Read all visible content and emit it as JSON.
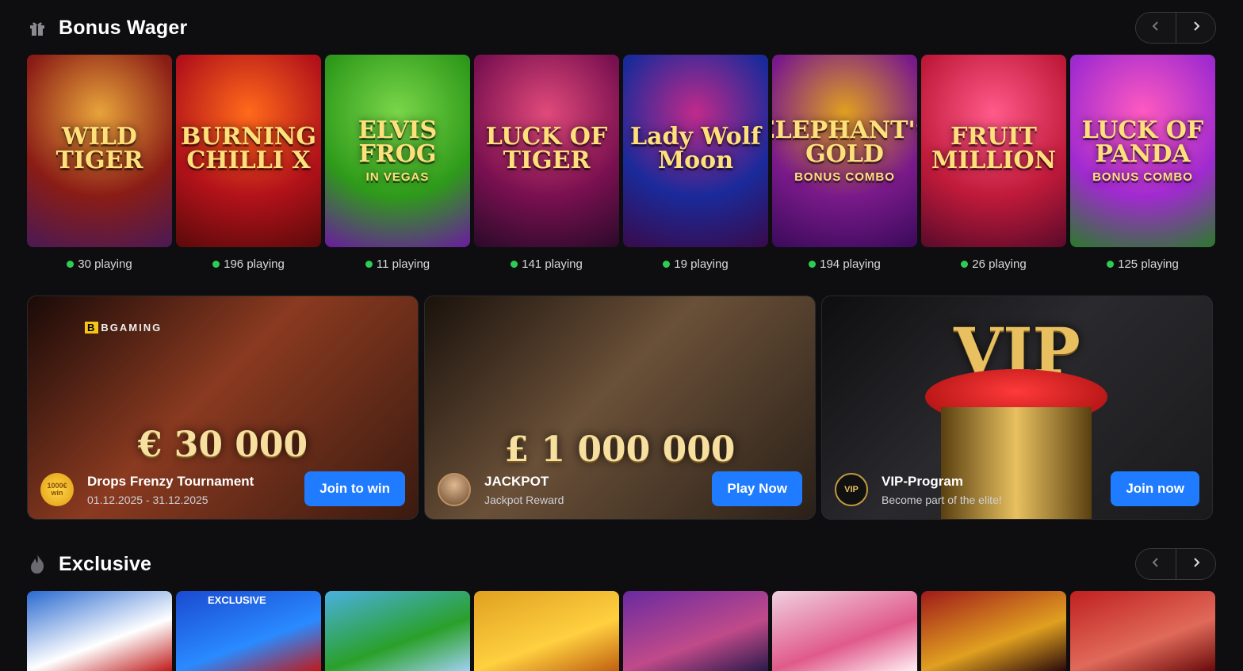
{
  "sections": {
    "bonus_wager": {
      "title": "Bonus Wager"
    },
    "exclusive": {
      "title": "Exclusive"
    }
  },
  "bonus_games": [
    {
      "name": "WILD TIGER",
      "sub": "",
      "playing": "30 playing",
      "colors": [
        "#8a1c16",
        "#e8a33a",
        "#4a1a55"
      ]
    },
    {
      "name": "BURNING CHILLI X",
      "sub": "",
      "playing": "196 playing",
      "colors": [
        "#b3121a",
        "#ff6a1a",
        "#5a0a0a"
      ]
    },
    {
      "name": "ELVIS FROG",
      "sub": "IN VEGAS",
      "playing": "11 playing",
      "colors": [
        "#2e9a1a",
        "#7ad64a",
        "#6a1aa0"
      ]
    },
    {
      "name": "LUCK OF TIGER",
      "sub": "",
      "playing": "141 playing",
      "colors": [
        "#7a1050",
        "#e04a7a",
        "#2a0a2a"
      ]
    },
    {
      "name": "Lady Wolf Moon",
      "sub": "",
      "playing": "19 playing",
      "colors": [
        "#1a2a9a",
        "#c02a8a",
        "#3a0a4a"
      ]
    },
    {
      "name": "ELEPHANT'S GOLD",
      "sub": "BONUS COMBO",
      "playing": "194 playing",
      "colors": [
        "#7a1a8a",
        "#e0a020",
        "#3a0a5a"
      ]
    },
    {
      "name": "FRUIT MILLION",
      "sub": "",
      "playing": "26 playing",
      "colors": [
        "#c01a3a",
        "#ff5a8a",
        "#5a0a2a"
      ]
    },
    {
      "name": "LUCK OF PANDA",
      "sub": "BONUS COMBO",
      "playing": "125 playing",
      "colors": [
        "#a02ad0",
        "#ff5ac0",
        "#2a7a2a"
      ]
    }
  ],
  "promos": [
    {
      "provider": "BGAMING",
      "amount": "€ 30 000",
      "title": "Drops Frenzy Tournament",
      "subtitle": "01.12.2025 - 31.12.2025",
      "badge": "1000€ win",
      "cta": "Join to win",
      "colors": [
        "#3a1a10",
        "#8a3a20",
        "#1a0a08"
      ]
    },
    {
      "amount": "£ 1 000 000",
      "title": "JACKPOT",
      "subtitle": "Jackpot Reward",
      "cta": "Play Now",
      "colors": [
        "#2a2018",
        "#6a5038",
        "#1a120c"
      ]
    },
    {
      "amount": "VIP",
      "title": "VIP-Program",
      "subtitle": "Become part of the elite!",
      "badge": "VIP",
      "cta": "Join now",
      "colors": [
        "#1a1a1c",
        "#2a2a2e",
        "#0e0e10"
      ]
    }
  ],
  "exclusive_games": [
    {
      "label": "",
      "colors": [
        "#2a6ad0",
        "#ffffff",
        "#c01a1a"
      ]
    },
    {
      "label": "EXCLUSIVE",
      "colors": [
        "#1a4ad0",
        "#2a8aff",
        "#c01a1a"
      ]
    },
    {
      "label": "",
      "colors": [
        "#4ab0e0",
        "#2aa02a",
        "#a0d0f0"
      ]
    },
    {
      "label": "",
      "colors": [
        "#e0a020",
        "#ffd040",
        "#c06010"
      ]
    },
    {
      "label": "",
      "colors": [
        "#6a2aa0",
        "#c04a8a",
        "#2a1a4a"
      ]
    },
    {
      "label": "",
      "colors": [
        "#f0d0e0",
        "#e05a8a",
        "#fff0f4"
      ]
    },
    {
      "label": "",
      "colors": [
        "#a01a1a",
        "#e0a020",
        "#2a0a0a"
      ]
    },
    {
      "label": "",
      "colors": [
        "#c02020",
        "#e06a5a",
        "#6a0a0a"
      ]
    }
  ]
}
